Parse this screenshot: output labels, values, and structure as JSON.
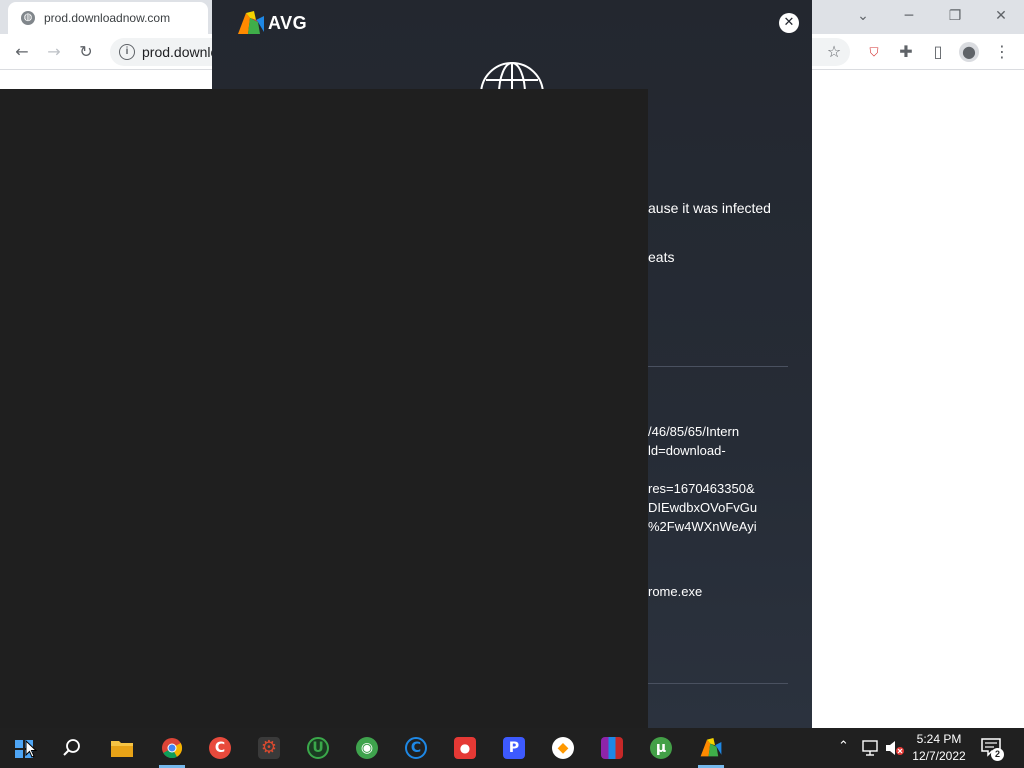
{
  "browser": {
    "tab_title": "prod.downloadnow.com",
    "favicon": "globe-icon",
    "url": "prod.downloadnow.com",
    "controls": {
      "minimize": "─",
      "restore": "❐",
      "close": "✕",
      "tab_search": "⌄"
    }
  },
  "avg": {
    "logo_text": "AVG",
    "close": "✕",
    "visible_text": {
      "line1": "ause it was infected",
      "line2": "eats",
      "url_line1": "/46/85/65/Intern",
      "url_line2": "ld=download-",
      "url_line3": "res=1670463350&",
      "url_line4": "DIEwdbxOVoFvGu",
      "url_line5": "%2Fw4WXnWeAyi",
      "process": "rome.exe"
    }
  },
  "taskbar": {
    "apps": [
      {
        "name": "start",
        "icon": "windows-start-icon"
      },
      {
        "name": "search",
        "icon": "search-icon"
      },
      {
        "name": "file-explorer",
        "icon": "folder-icon",
        "color": "#f6c444"
      },
      {
        "name": "chrome",
        "icon": "chrome-icon",
        "color": "#4285f4",
        "active": true
      },
      {
        "name": "ccleaner",
        "icon": "ccleaner-icon",
        "color": "#e84a3c"
      },
      {
        "name": "app-gear",
        "icon": "gear-app-icon",
        "color": "#d94a2f"
      },
      {
        "name": "app-u",
        "icon": "u-circle-icon",
        "color": "#3aa84a"
      },
      {
        "name": "app-globe",
        "icon": "globe-app-icon",
        "color": "#3fa34d"
      },
      {
        "name": "app-c",
        "icon": "c-circle-icon",
        "color": "#1e88e5"
      },
      {
        "name": "app-camera",
        "icon": "camera-app-icon",
        "color": "#e53935"
      },
      {
        "name": "app-p",
        "icon": "p-app-icon",
        "color": "#3d5afe"
      },
      {
        "name": "app-vpn",
        "icon": "shield-app-icon",
        "color": "#ff9800"
      },
      {
        "name": "winrar",
        "icon": "winrar-icon",
        "color": "#8e24aa"
      },
      {
        "name": "utorrent",
        "icon": "utorrent-icon",
        "color": "#43a047"
      },
      {
        "name": "avg",
        "icon": "avg-icon",
        "color": "#2e7d32",
        "active": true
      }
    ],
    "tray": {
      "time": "5:24 PM",
      "date": "12/7/2022",
      "notifications_count": "2"
    }
  }
}
